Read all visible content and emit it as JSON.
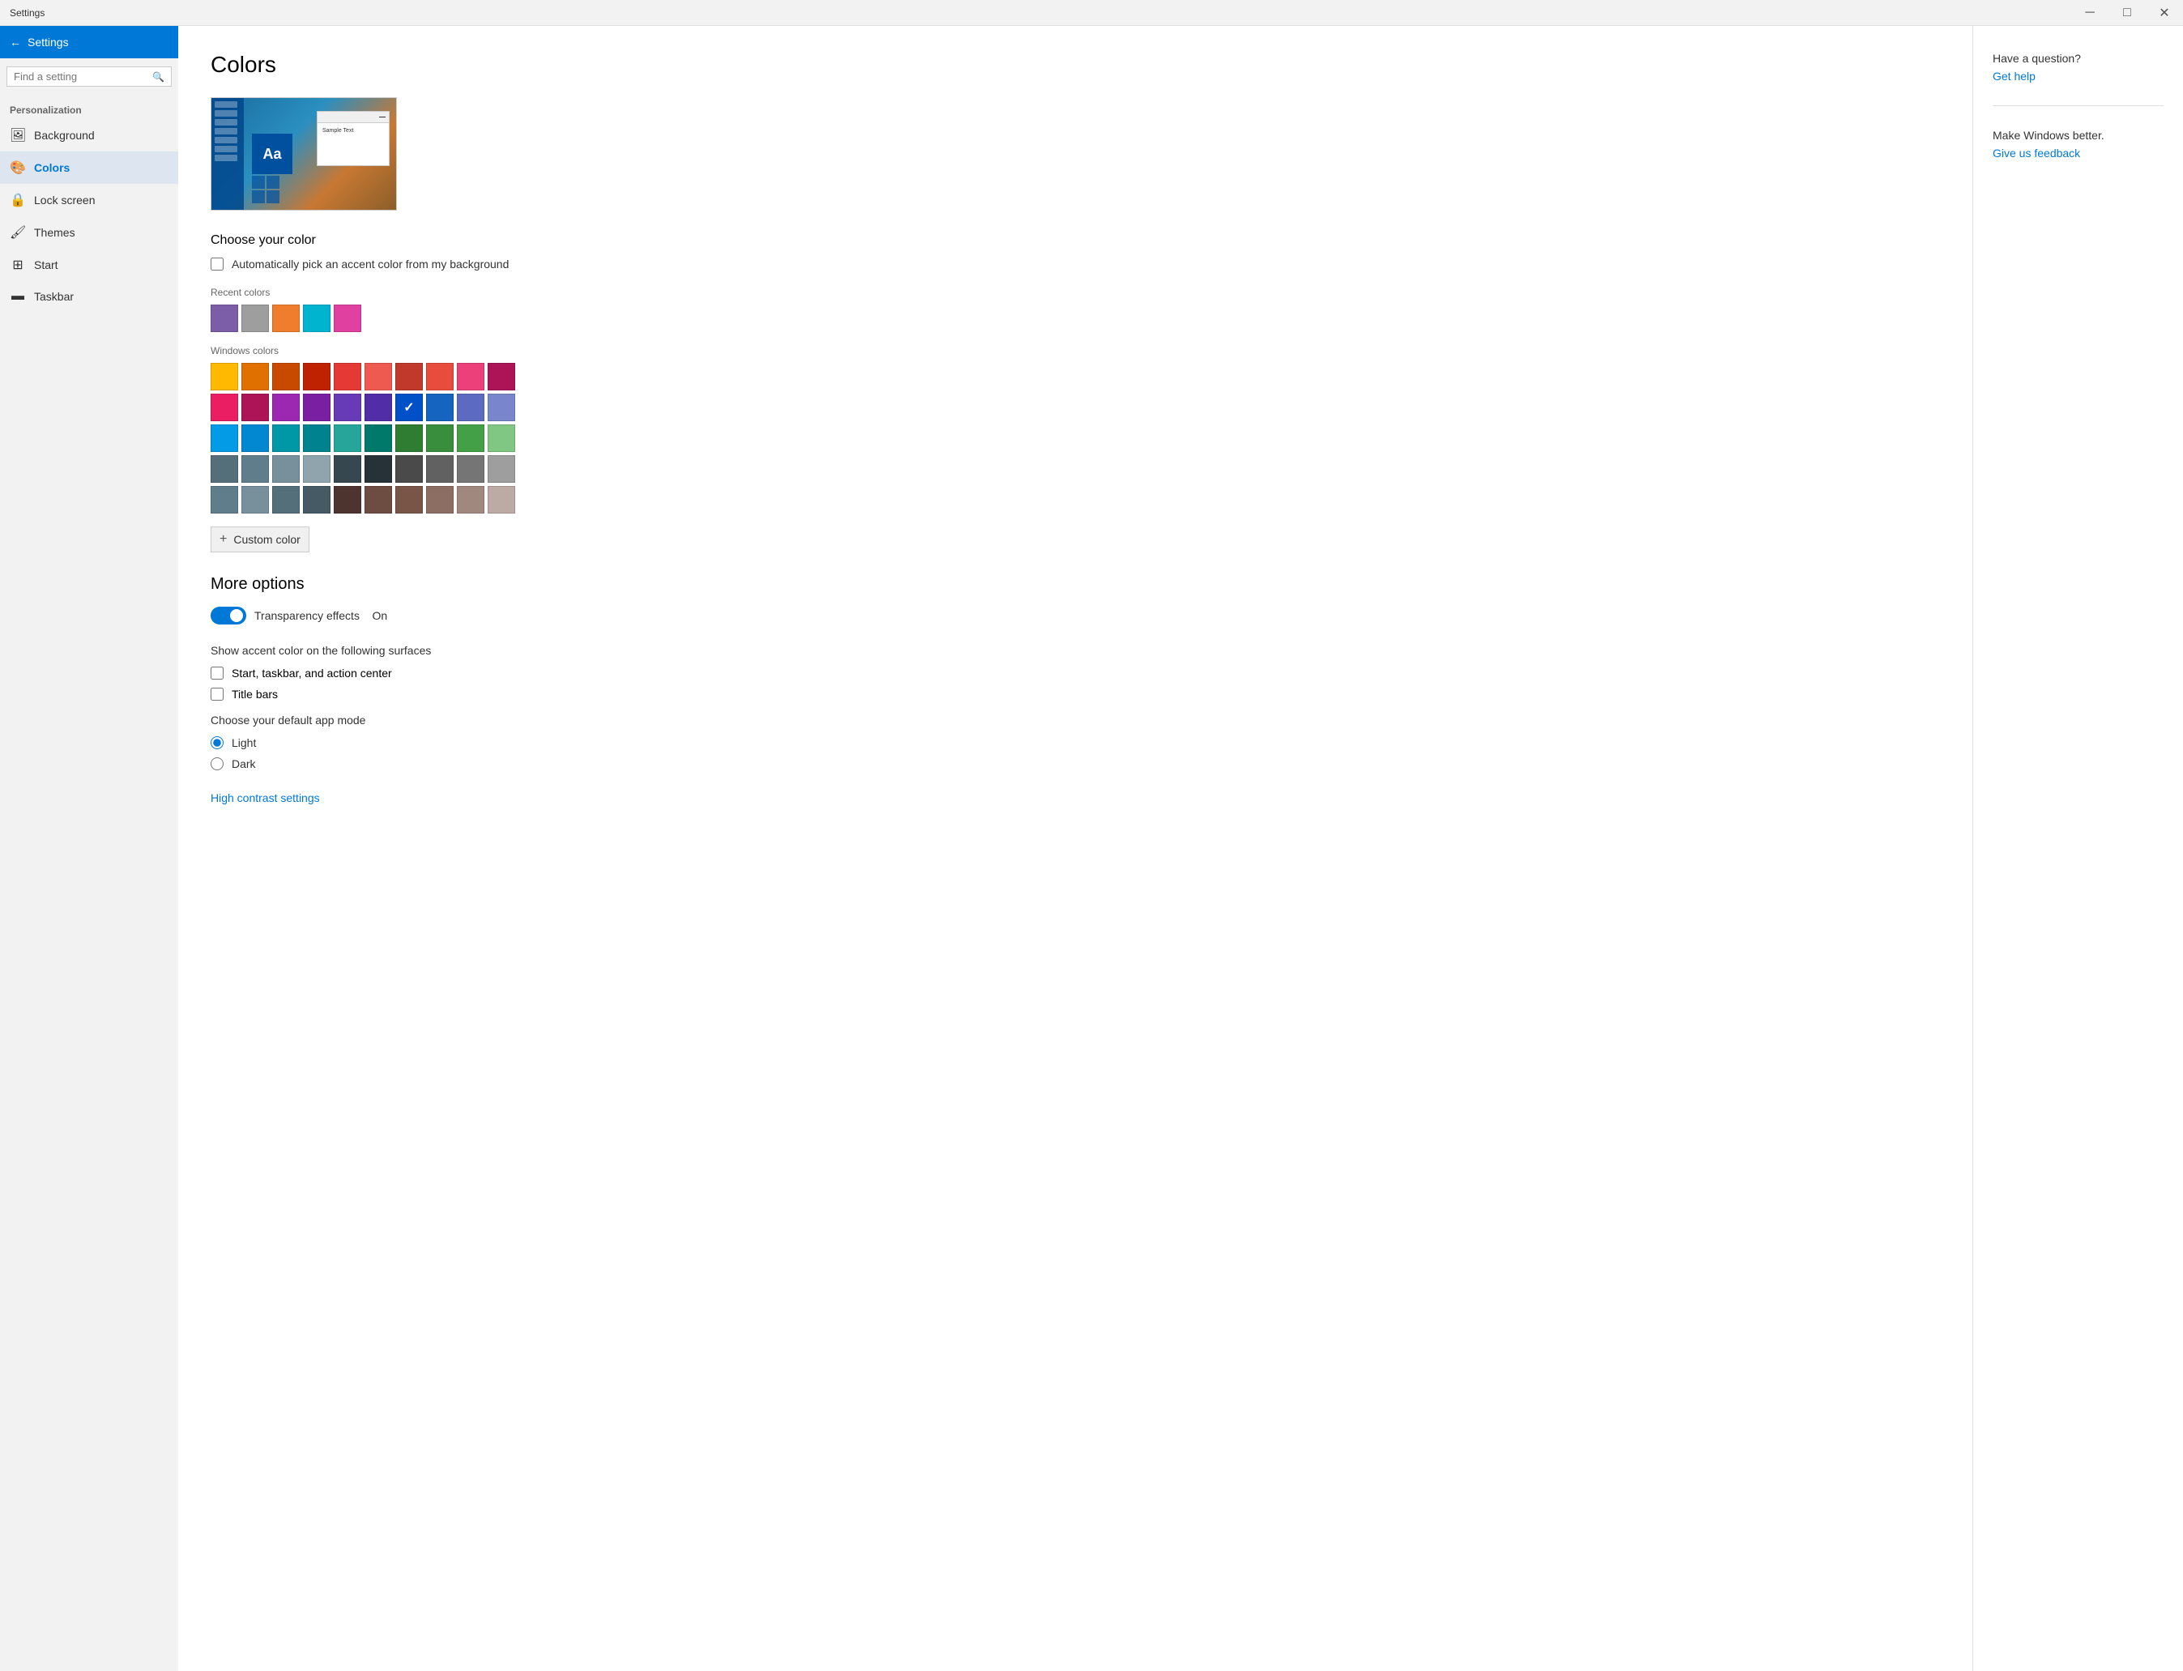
{
  "titlebar": {
    "title": "Settings",
    "minimize_label": "─",
    "maximize_label": "□",
    "close_label": "✕"
  },
  "sidebar": {
    "back_label": "Settings",
    "search_placeholder": "Find a setting",
    "section_label": "Personalization",
    "nav_items": [
      {
        "id": "background",
        "icon": "🖼",
        "label": "Background"
      },
      {
        "id": "colors",
        "icon": "🎨",
        "label": "Colors",
        "active": true
      },
      {
        "id": "lock-screen",
        "icon": "🔒",
        "label": "Lock screen"
      },
      {
        "id": "themes",
        "icon": "🖌",
        "label": "Themes"
      },
      {
        "id": "start",
        "icon": "⊞",
        "label": "Start"
      },
      {
        "id": "taskbar",
        "icon": "▬",
        "label": "Taskbar"
      }
    ]
  },
  "main": {
    "page_title": "Colors",
    "preview_aa": "Aa",
    "preview_sample": "Sample Text",
    "choose_color_title": "Choose your color",
    "auto_pick_label": "Automatically pick an accent color from my background",
    "auto_pick_checked": false,
    "recent_colors_label": "Recent colors",
    "recent_colors": [
      {
        "hex": "#7B5EA7"
      },
      {
        "hex": "#9E9E9E"
      },
      {
        "hex": "#F07D2E"
      },
      {
        "hex": "#00B4D0"
      },
      {
        "hex": "#E040A0"
      }
    ],
    "windows_colors_label": "Windows colors",
    "windows_colors": [
      "#FFB900",
      "#E67E22",
      "#D35400",
      "#C0392B",
      "#E74C3C",
      "#E8786A",
      "#C0392B",
      "#E74C3C",
      "#E91E63",
      "#C2185B",
      "#E91E63",
      "#AD1457",
      "#9C27B0",
      "#7B1FA2",
      "#673AB7",
      "#512DA8",
      "#0050C8",
      "#1565C0",
      "#5C6BC0",
      "#7986CB",
      "#039BE5",
      "#0288D1",
      "#00ACC1",
      "#00838F",
      "#26A69A",
      "#00796B",
      "#2E7D32",
      "#388E3C",
      "#43A047",
      "#66BB6A",
      "#546E7A",
      "#607D8B",
      "#78909C",
      "#90A4AE",
      "#455A64",
      "#37474F",
      "#4E4E4E",
      "#616161",
      "#757575",
      "#9E9E9E",
      "#BDBDBD",
      "#757575",
      "#616161",
      "#4E342E",
      "#6D4C41",
      "#8D6E63",
      "#A1887F",
      "#795548",
      "#5D4037",
      "#795548",
      "#6D4C41",
      "#4E342E"
    ],
    "selected_color_index": 16,
    "custom_color_label": "Custom color",
    "more_options_title": "More options",
    "transparency_label": "Transparency effects",
    "transparency_on": true,
    "transparency_on_label": "On",
    "show_accent_label": "Show accent color on the following surfaces",
    "surface_start_label": "Start, taskbar, and action center",
    "surface_start_checked": false,
    "surface_titlebars_label": "Title bars",
    "surface_titlebars_checked": false,
    "default_app_mode_label": "Choose your default app mode",
    "mode_light_label": "Light",
    "mode_dark_label": "Dark",
    "mode_selected": "light",
    "high_contrast_link": "High contrast settings"
  },
  "right_panel": {
    "question_title": "Have a question?",
    "get_help_label": "Get help",
    "make_better_title": "Make Windows better.",
    "feedback_label": "Give us feedback"
  }
}
